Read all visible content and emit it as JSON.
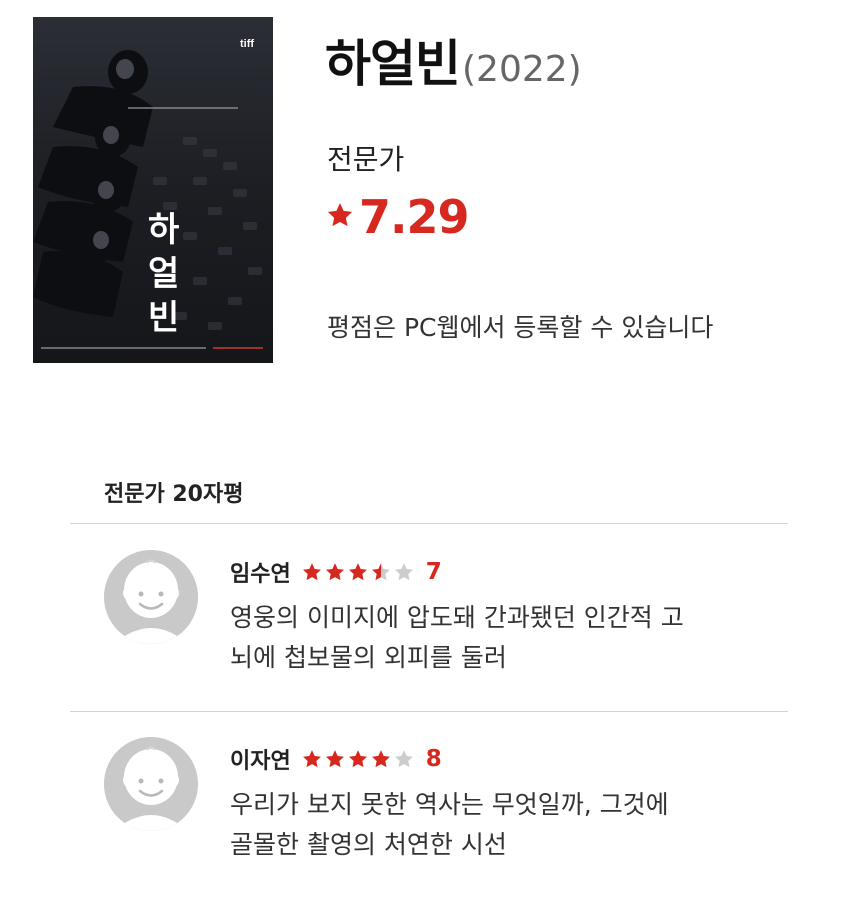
{
  "poster": {
    "badge": "tiff",
    "title_chars": [
      "하",
      "얼",
      "빈"
    ]
  },
  "movie": {
    "title": "하얼빈",
    "year": "(2022)"
  },
  "critic": {
    "label": "전문가",
    "star_icon": "star-icon",
    "score": "7.29",
    "notice": "평점은 PC웹에서 등록할 수 있습니다"
  },
  "reviews_section": {
    "title": "전문가 20자평",
    "items": [
      {
        "name": "임수연",
        "rating": 7,
        "rating_max": 10,
        "score": "7",
        "lines": [
          "영웅의 이미지에 압도돼 간과됐던 인간적 고",
          "뇌에 첩보물의 외피를 둘러"
        ]
      },
      {
        "name": "이자연",
        "rating": 8,
        "rating_max": 10,
        "score": "8",
        "lines": [
          "우리가 보지 못한 역사는 무엇일까, 그것에",
          "골몰한 촬영의 처연한 시선"
        ]
      }
    ]
  },
  "colors": {
    "accent_red": "#d6281e",
    "star_empty": "#cccccc",
    "divider": "#d4d4d4",
    "avatar_bg": "#c9c9c9"
  }
}
